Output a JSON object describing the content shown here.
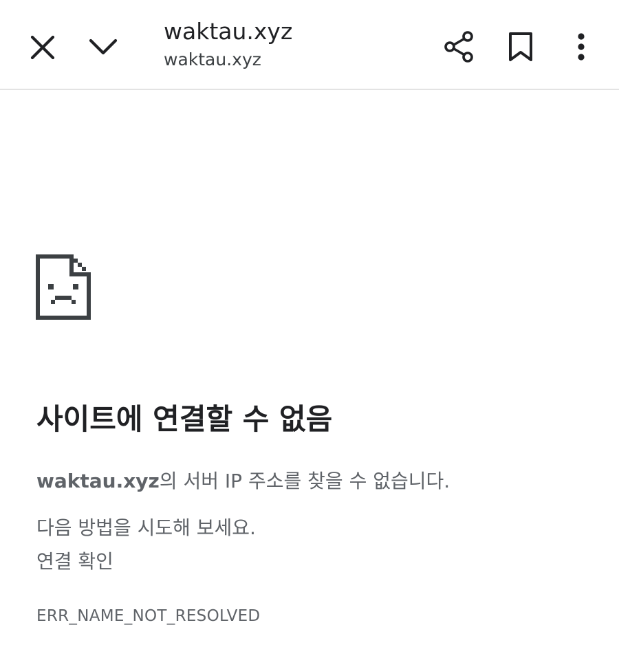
{
  "toolbar": {
    "title": "waktau.xyz",
    "url": "waktau.xyz",
    "icons": {
      "close": "close-icon",
      "collapse": "chevron-down-icon",
      "share": "share-icon",
      "bookmark": "bookmark-icon",
      "menu": "more-vert-icon"
    }
  },
  "error_page": {
    "icon": "sad-page-icon",
    "heading": "사이트에 연결할 수 없음",
    "host": "waktau.xyz",
    "description_suffix": "의 서버 IP 주소를 찾을 수 없습니다.",
    "suggestion_intro": "다음 방법을 시도해 보세요.",
    "suggestions": [
      "연결 확인"
    ],
    "error_code": "ERR_NAME_NOT_RESOLVED"
  },
  "colors": {
    "text_primary": "#202124",
    "text_secondary": "#5f6368",
    "icon": "#3c4043",
    "divider": "#e3e3e3"
  }
}
